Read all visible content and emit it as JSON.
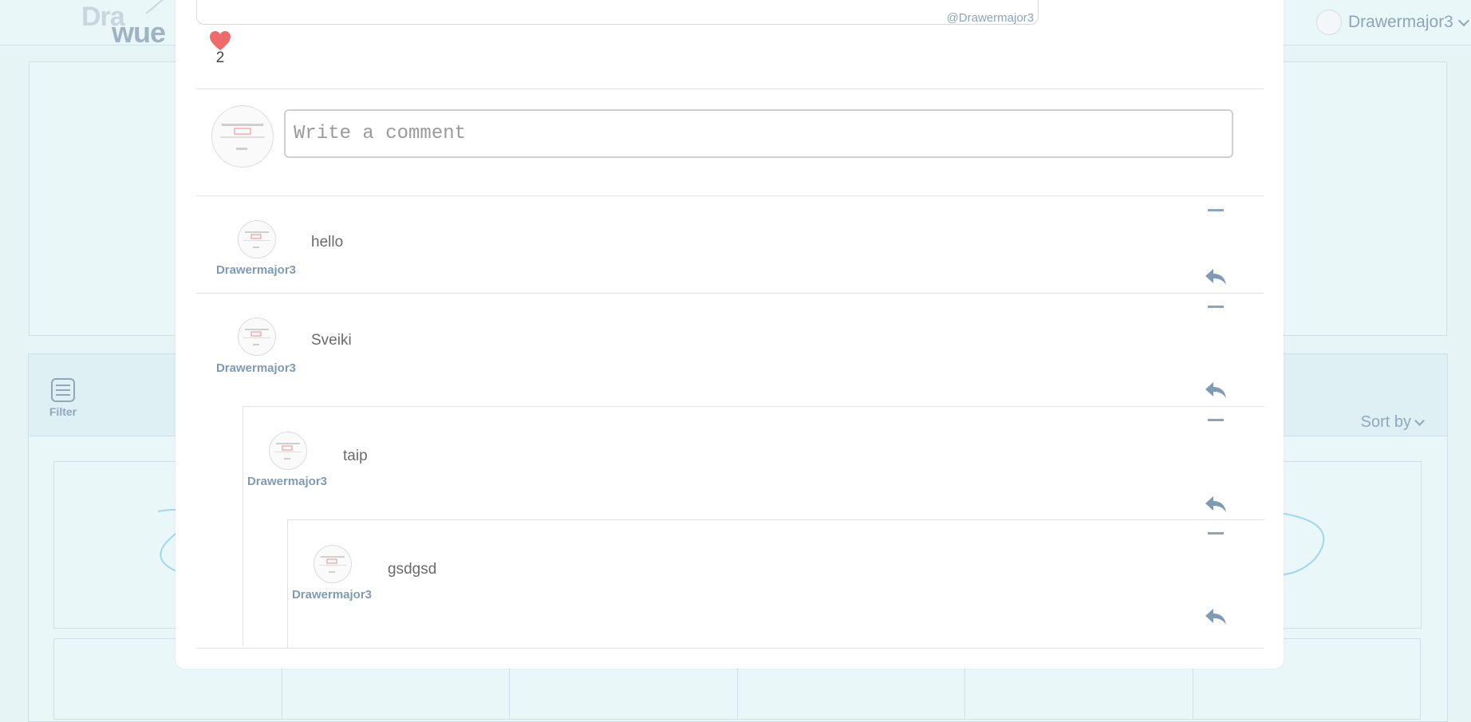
{
  "header": {
    "logo_top": "Dra",
    "logo_bottom": "wue",
    "username": "Drawermajor3"
  },
  "toolbar": {
    "filter_label": "Filter",
    "sort_label": "Sort by"
  },
  "post": {
    "like_count": "2",
    "author_tag": "@Drawermajor3"
  },
  "composer": {
    "placeholder": "Write a comment"
  },
  "comments": [
    {
      "author": "Drawermajor3",
      "text": "hello"
    },
    {
      "author": "Drawermajor3",
      "text": "Sveiki"
    },
    {
      "author": "Drawermajor3",
      "text": "taip"
    },
    {
      "author": "Drawermajor3",
      "text": "gsdgsd"
    }
  ],
  "colors": {
    "accent": "#8ea5b8",
    "heart": "#f06a6a",
    "background": "#e6f4f6"
  },
  "icons": [
    "heart-icon",
    "reply-icon",
    "collapse-icon",
    "filter-icon",
    "chevron-down-icon"
  ]
}
